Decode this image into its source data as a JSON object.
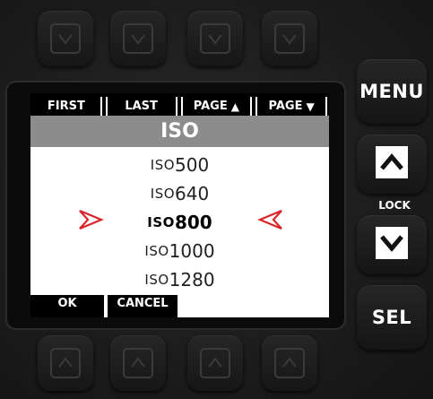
{
  "top_softkeys": [
    {
      "label": "FIRST"
    },
    {
      "label": "LAST"
    },
    {
      "label": "PAGE",
      "arrow": "▲"
    },
    {
      "label": "PAGE",
      "arrow": "▼"
    }
  ],
  "title": "ISO",
  "iso_list": [
    {
      "prefix": "ISO",
      "value": "500"
    },
    {
      "prefix": "ISO",
      "value": "640"
    },
    {
      "prefix": "ISO",
      "value": "800"
    },
    {
      "prefix": "ISO",
      "value": "1000"
    },
    {
      "prefix": "ISO",
      "value": "1280"
    }
  ],
  "selected_index": 2,
  "bottom_softkeys": {
    "ok": "OK",
    "cancel": "CANCEL"
  },
  "side_buttons": {
    "menu": "MENU",
    "lock": "LOCK",
    "sel": "SEL"
  },
  "colors": {
    "selection_arrows": "#d8242a",
    "title_bar": "#8c8c8c"
  }
}
